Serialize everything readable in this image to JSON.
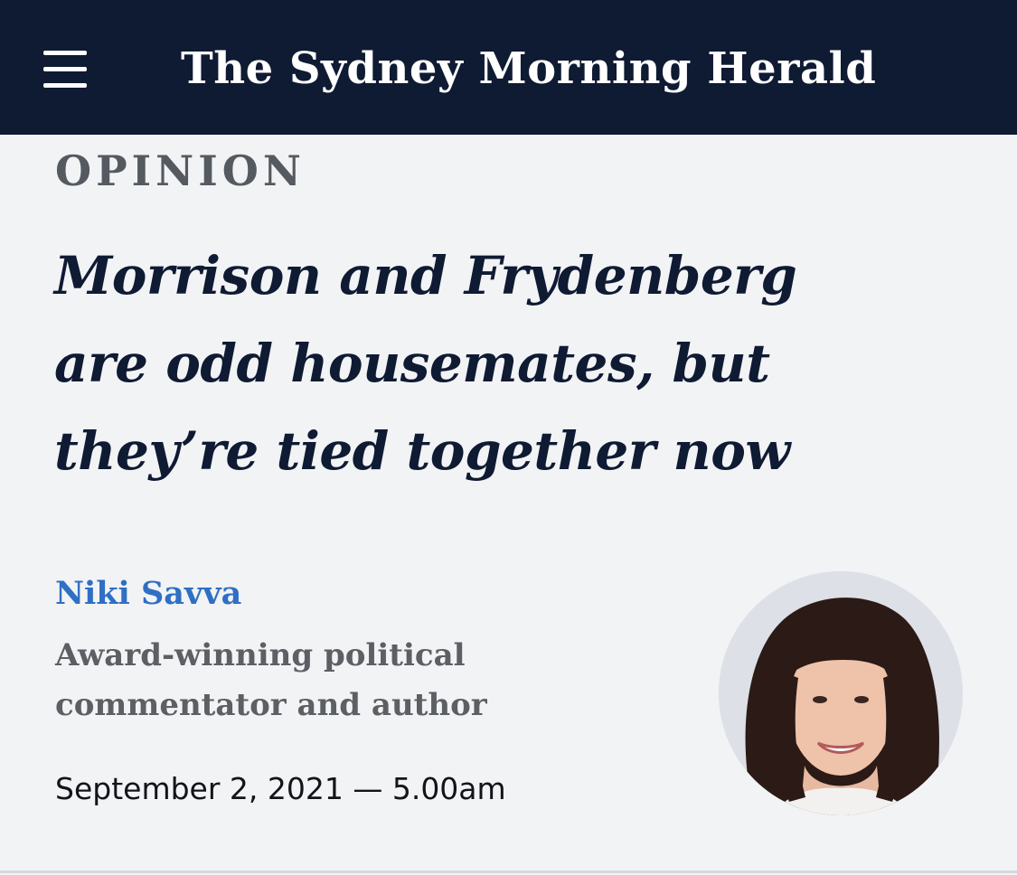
{
  "header": {
    "menu_icon": "hamburger-menu-icon",
    "masthead": "The Sydney Morning Herald"
  },
  "article": {
    "section": "OPINION",
    "headline_lines": [
      "Morrison and Frydenberg",
      "are odd housemates, but",
      "they’re tied together now"
    ],
    "author": {
      "name": "Niki Savva",
      "bio_lines": [
        "Award-winning political",
        "commentator and author"
      ],
      "photo": "author-portrait"
    },
    "published": "September 2, 2021 — 5.00am"
  },
  "colors": {
    "header_bg": "#0f1a33",
    "page_bg": "#f2f3f5",
    "headline": "#0f1a33",
    "author_link": "#2f6fc4",
    "section_label": "#555a60",
    "bio": "#5c5f63"
  }
}
